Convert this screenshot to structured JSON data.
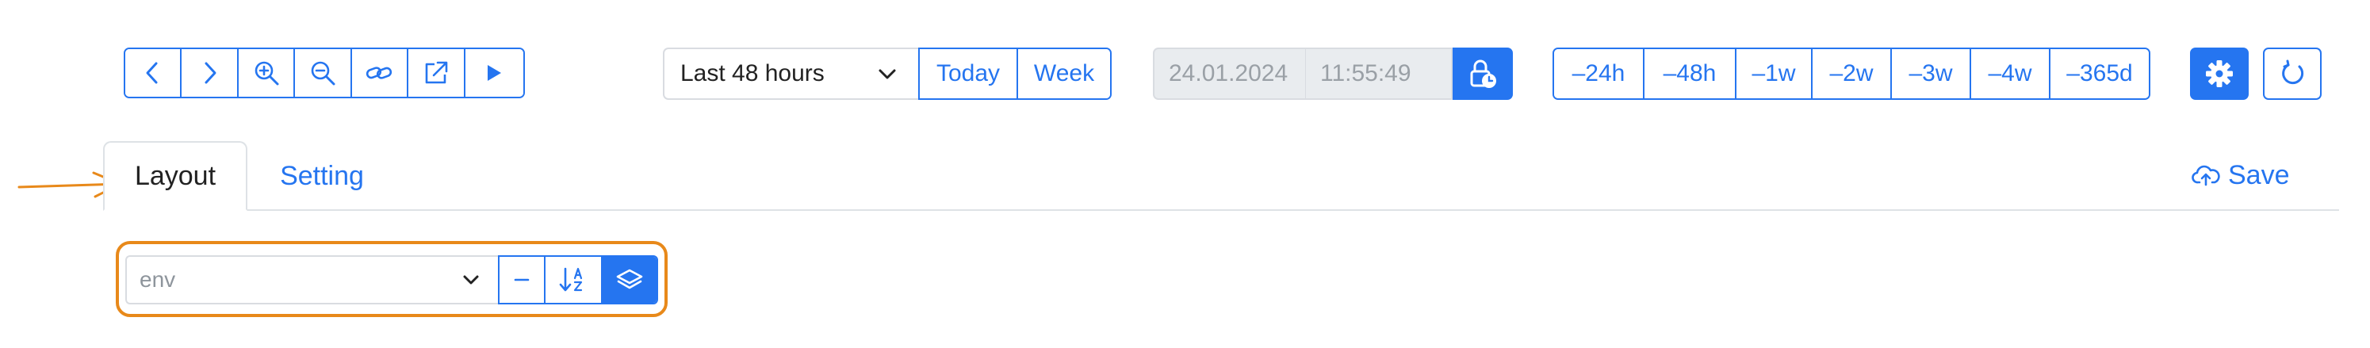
{
  "toolbar": {
    "nav_icons": [
      "chevron-left-icon",
      "chevron-right-icon",
      "zoom-in-icon",
      "zoom-out-icon",
      "link-icon",
      "external-link-icon",
      "play-icon"
    ]
  },
  "time_range": {
    "selected": "Last 48 hours",
    "today_label": "Today",
    "week_label": "Week"
  },
  "datetime": {
    "date": "24.01.2024",
    "time": "11:55:49"
  },
  "relative_presets": [
    "–24h",
    "–48h",
    "–1w",
    "–2w",
    "–3w",
    "–4w",
    "–365d"
  ],
  "tabs": [
    {
      "label": "Layout",
      "active": true
    },
    {
      "label": "Setting",
      "active": false
    }
  ],
  "save_label": "Save",
  "env": {
    "placeholder": "env"
  },
  "colors": {
    "accent": "#2575f0",
    "highlight": "#e8891a",
    "disabled_bg": "#e9ecef"
  }
}
